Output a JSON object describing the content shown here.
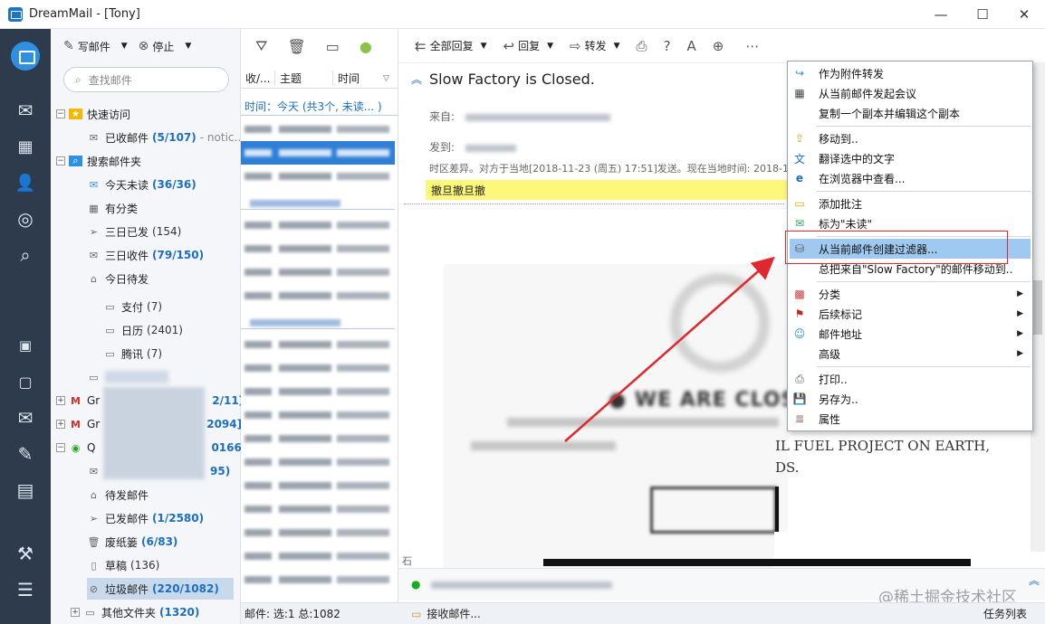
{
  "window": {
    "title": "DreamMail - [Tony]",
    "min": "—",
    "max": "☐",
    "close": "✕"
  },
  "colors": {
    "rail_bg": "#2e3b4d",
    "accent": "#1b6ec2",
    "selection": "#2f7fd6",
    "menu_highlight": "#9fc9f0",
    "annotation_red": "#e0282e",
    "banner_yellow": "#fdf77b"
  },
  "folder_toolbar": {
    "compose": "写邮件",
    "stop": "停止"
  },
  "search": {
    "placeholder": "查找邮件"
  },
  "tree": {
    "quick_access": "快速访问",
    "received": "已收邮件",
    "received_count": "(5/107)",
    "received_extra": "- notic...",
    "search_folders": "搜索邮件夹",
    "today_unread": "今天未读",
    "today_unread_count": "(36/36)",
    "categorized": "有分类",
    "three_day_sent": "三日已发",
    "three_day_sent_count": "(154)",
    "three_day_recv": "三日收件",
    "three_day_recv_count": "(79/150)",
    "today_todo": "今日待发",
    "pay": "支付",
    "pay_count": "(7)",
    "calendar": "日历",
    "calendar_count": "(2401)",
    "tencent": "腾讯",
    "tencent_count": "(7)",
    "gmail1_prefix": "Gr",
    "gmail1_count": "2/11]",
    "gmail2_prefix": "Gr",
    "gmail2_count": "2094]",
    "qq_prefix": "Q",
    "qq_count": "0166]",
    "qq_inbox_count": "95)",
    "outbox": "待发邮件",
    "sent": "已发邮件",
    "sent_count": "(1/2580)",
    "trash": "废纸篓",
    "trash_count": "(6/83)",
    "drafts": "草稿",
    "drafts_count": "(136)",
    "spam": "垃圾邮件",
    "spam_count": "(220/1082)",
    "other": "其他文件夹",
    "other_count": "(1320)"
  },
  "list": {
    "col_from": "收/...",
    "col_subject": "主题",
    "col_time": "时间",
    "group_today": "时间：今天 (共3个, 未读... )",
    "status": "邮件: 选:1 总:1082"
  },
  "reader_toolbar": {
    "reply_all": "全部回复",
    "reply": "回复",
    "forward": "转发"
  },
  "message": {
    "subject": "Slow Factory is Closed.",
    "from_label": "来自:",
    "to_label": "发到:",
    "tz_line": "时区差异。对方于当地[2018-11-23 (周五) 17:51]发送。现在当地时间: 2018-11-2",
    "banner": "撤旦撤旦撤",
    "closed_text": "● WE ARE CLOSE",
    "fossil_text": "IL FUEL PROJECT ON EARTH,",
    "sands_text": "DS.",
    "left_edge_text": "石"
  },
  "status": {
    "receiving": "接收邮件...",
    "tasks": "任务列表"
  },
  "watermark": "@稀土掘金技术社区",
  "context_menu": {
    "items": [
      {
        "label": "作为附件转发",
        "icon": "↪"
      },
      {
        "label": "从当前邮件发起会议",
        "icon": "▦"
      },
      {
        "label": "复制一个副本并编辑这个副本",
        "icon": ""
      },
      {
        "label": "移动到..",
        "icon": "⇪"
      },
      {
        "label": "翻译选中的文字",
        "icon": "文"
      },
      {
        "label": "在浏览器中查看...",
        "icon": "e"
      },
      {
        "label": "添加批注",
        "icon": "▭"
      },
      {
        "label": "标为\"未读\"",
        "icon": "✉"
      },
      {
        "label": "从当前邮件创建过滤器...",
        "icon": "⛁"
      },
      {
        "label": "总把来自\"Slow Factory\"的邮件移动到..",
        "icon": ""
      },
      {
        "label": "分类",
        "icon": "▩"
      },
      {
        "label": "后续标记",
        "icon": "⚑"
      },
      {
        "label": "邮件地址",
        "icon": "☺"
      },
      {
        "label": "高级",
        "icon": ""
      },
      {
        "label": "打印..",
        "icon": "⎙"
      },
      {
        "label": "另存为..",
        "icon": "💾"
      },
      {
        "label": "属性",
        "icon": "≣"
      }
    ],
    "submenu_arrow": "▶"
  }
}
